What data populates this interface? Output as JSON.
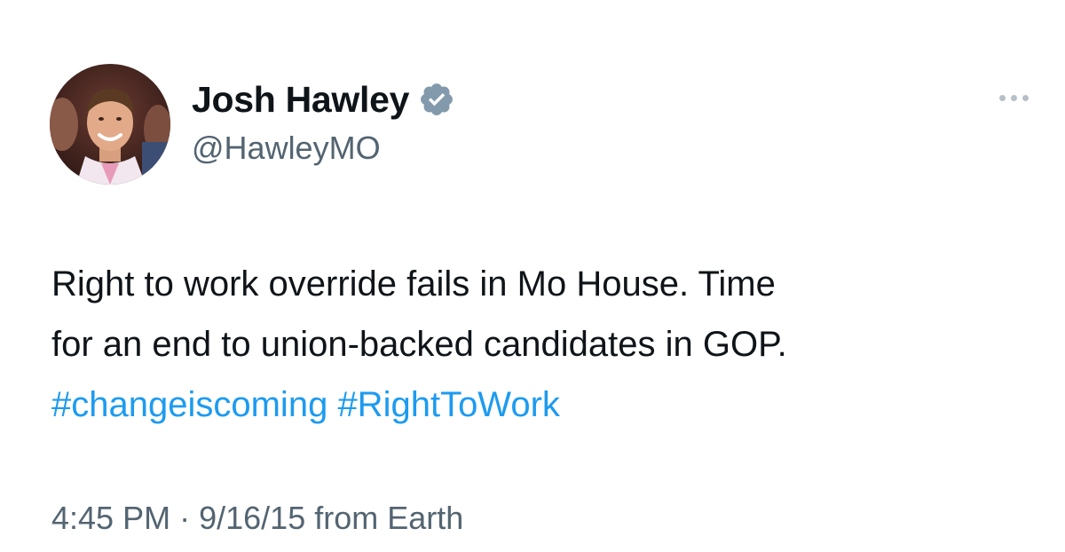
{
  "author": {
    "display_name": "Josh Hawley",
    "handle": "@HawleyMO",
    "verified_icon": "verified-badge-icon",
    "verified_color": "#829aab"
  },
  "tweet": {
    "line1": "Right to work override fails in Mo House. Time",
    "line2": "for an end to union-backed candidates in GOP.",
    "hashtags": [
      "#changeiscoming",
      "#RightToWork"
    ],
    "hashtag_color": "#1d9bf0"
  },
  "meta": {
    "time": "4:45 PM",
    "separator": "·",
    "date": "9/16/15",
    "source": "from Earth"
  },
  "icons": {
    "more": "more-options-icon",
    "avatar": "profile-photo"
  }
}
